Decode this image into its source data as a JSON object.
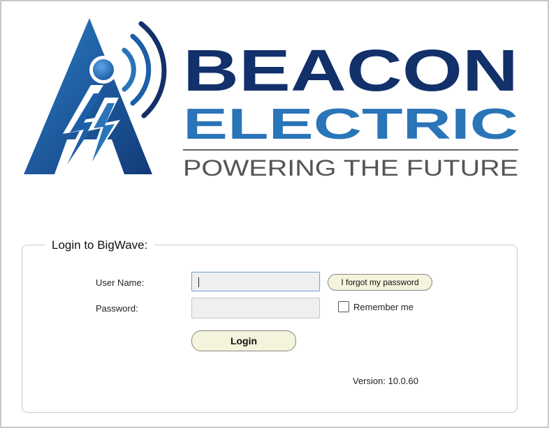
{
  "brand": {
    "line1": "BEACON",
    "line2": "ELECTRIC",
    "tagline": "POWERING THE FUTURE",
    "colors": {
      "navy": "#12306a",
      "blue": "#2a74b8",
      "gray": "#555555"
    }
  },
  "login": {
    "legend": "Login to BigWave:",
    "username_label": "User Name:",
    "password_label": "Password:",
    "username_value": "",
    "password_value": "",
    "forgot_label": "I forgot my password",
    "remember_label": "Remember me",
    "remember_checked": false,
    "login_label": "Login"
  },
  "version": {
    "text": "Version: 10.0.60"
  }
}
